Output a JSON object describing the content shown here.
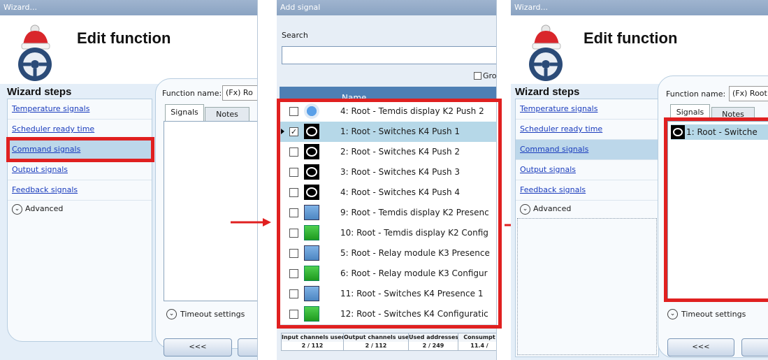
{
  "left_panel": {
    "window_title": "Wizard...",
    "header_title": "Edit function",
    "steps_title": "Wizard steps",
    "steps": [
      {
        "label": "Temperature signals"
      },
      {
        "label": "Scheduler ready time"
      },
      {
        "label": "Command signals"
      },
      {
        "label": "Output signals"
      },
      {
        "label": "Feedback signals"
      }
    ],
    "advanced_label": "Advanced",
    "function_name_label": "Function name:",
    "function_name_value": "(Fx) Ro",
    "tabs": [
      {
        "label": "Signals"
      },
      {
        "label": "Notes"
      }
    ],
    "timeout_label": "Timeout settings",
    "back_button": "<<<"
  },
  "middle_panel": {
    "window_title": "Add signal",
    "search_label": "Search",
    "search_value": "",
    "group_label": "Grou",
    "column_name": "Name",
    "rows": [
      {
        "name": "4: Root - Temdis display K2 Push 2",
        "checked": false,
        "icon": "info-icon"
      },
      {
        "name": "1: Root - Switches K4 Push 1",
        "checked": true,
        "icon": "pushbutton-icon"
      },
      {
        "name": "2: Root - Switches K4 Push 2",
        "checked": false,
        "icon": "pushbutton-icon"
      },
      {
        "name": "3: Root - Switches K4 Push 3",
        "checked": false,
        "icon": "pushbutton-icon"
      },
      {
        "name": "4: Root - Switches K4 Push 4",
        "checked": false,
        "icon": "pushbutton-icon"
      },
      {
        "name": "9: Root - Temdis display K2 Presenc",
        "checked": false,
        "icon": "presence-icon"
      },
      {
        "name": "10: Root - Temdis display K2 Config",
        "checked": false,
        "icon": "config-icon"
      },
      {
        "name": "5: Root - Relay module K3 Presence",
        "checked": false,
        "icon": "presence-icon"
      },
      {
        "name": "6: Root - Relay module K3 Configur",
        "checked": false,
        "icon": "config-icon"
      },
      {
        "name": "11: Root - Switches K4 Presence 1",
        "checked": false,
        "icon": "presence-icon"
      },
      {
        "name": "12: Root - Switches K4 Configuratic",
        "checked": false,
        "icon": "config-icon"
      }
    ],
    "stats": [
      {
        "label": "Input channels used",
        "value": "2 / 112"
      },
      {
        "label": "Output channels used",
        "value": "2 / 112"
      },
      {
        "label": "Used addresses",
        "value": "2 / 249"
      },
      {
        "label": "Consumpt",
        "value": "11.4 /"
      }
    ]
  },
  "right_panel": {
    "window_title": "Wizard...",
    "header_title": "Edit function",
    "steps_title": "Wizard steps",
    "steps": [
      {
        "label": "Temperature signals"
      },
      {
        "label": "Scheduler ready time"
      },
      {
        "label": "Command signals"
      },
      {
        "label": "Output signals"
      },
      {
        "label": "Feedback signals"
      }
    ],
    "advanced_label": "Advanced",
    "function_name_label": "Function name:",
    "function_name_value": "(Fx) Root",
    "tabs": [
      {
        "label": "Signals"
      },
      {
        "label": "Notes"
      }
    ],
    "signal_item": "1: Root - Switche",
    "timeout_label": "Timeout settings",
    "back_button": "<<<"
  },
  "colors": {
    "highlight": "#e02020",
    "selected_row": "#b6d8e8",
    "grid_header": "#4e7fb4"
  }
}
